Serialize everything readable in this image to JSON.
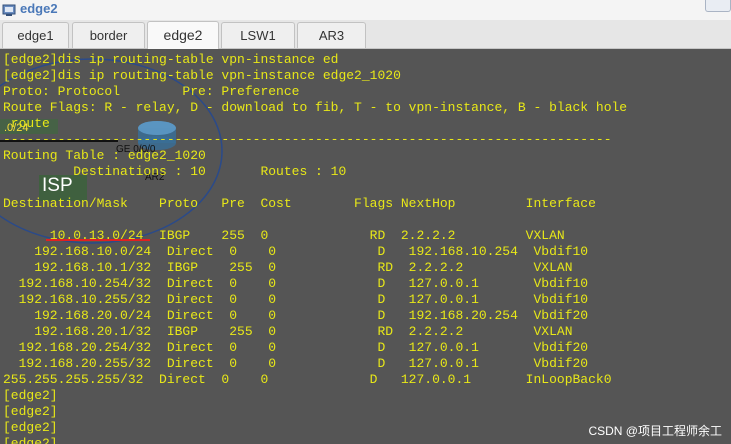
{
  "window": {
    "title": "edge2"
  },
  "tabs": [
    {
      "label": "edge1",
      "active": false
    },
    {
      "label": "border",
      "active": false
    },
    {
      "label": "edge2",
      "active": true
    },
    {
      "label": "LSW1",
      "active": false
    },
    {
      "label": "AR3",
      "active": false
    }
  ],
  "terminal": {
    "lines": [
      "[edge2]dis ip routing-table vpn-instance ed",
      "[edge2]dis ip routing-table vpn-instance edge2_1020",
      "Proto: Protocol        Pre: Preference",
      "Route Flags: R - relay, D - download to fib, T - to vpn-instance, B - black hole",
      " route",
      "------------------------------------------------------------------------------",
      "Routing Table : edge2_1020",
      "         Destinations : 10       Routes : 10",
      "",
      "Destination/Mask    Proto   Pre  Cost        Flags NextHop         Interface",
      "",
      "      10.0.13.0/24  IBGP    255  0             RD  2.2.2.2         VXLAN",
      "    192.168.10.0/24  Direct  0    0             D   192.168.10.254  Vbdif10",
      "    192.168.10.1/32  IBGP    255  0             RD  2.2.2.2         VXLAN",
      "  192.168.10.254/32  Direct  0    0             D   127.0.0.1       Vbdif10",
      "  192.168.10.255/32  Direct  0    0             D   127.0.0.1       Vbdif10",
      "    192.168.20.0/24  Direct  0    0             D   192.168.20.254  Vbdif20",
      "    192.168.20.1/32  IBGP    255  0             RD  2.2.2.2         VXLAN",
      "  192.168.20.254/32  Direct  0    0             D   127.0.0.1       Vbdif20",
      "  192.168.20.255/32  Direct  0    0             D   127.0.0.1       Vbdif20",
      "255.255.255.255/32  Direct  0    0             D   127.0.0.1       InLoopBack0",
      "[edge2]",
      "[edge2]",
      "[edge2]",
      "[edge2]"
    ]
  },
  "topology": {
    "net_label": ".0/24",
    "port_label": "GE 0/0/0",
    "router_label": "AR2",
    "isp_label": "ISP"
  },
  "watermark": "CSDN @项目工程师余工",
  "colors": {
    "terminal_bg": "#555555",
    "terminal_text": "#e8e818",
    "title_text": "#4a78b8",
    "underline": "#e02020"
  }
}
